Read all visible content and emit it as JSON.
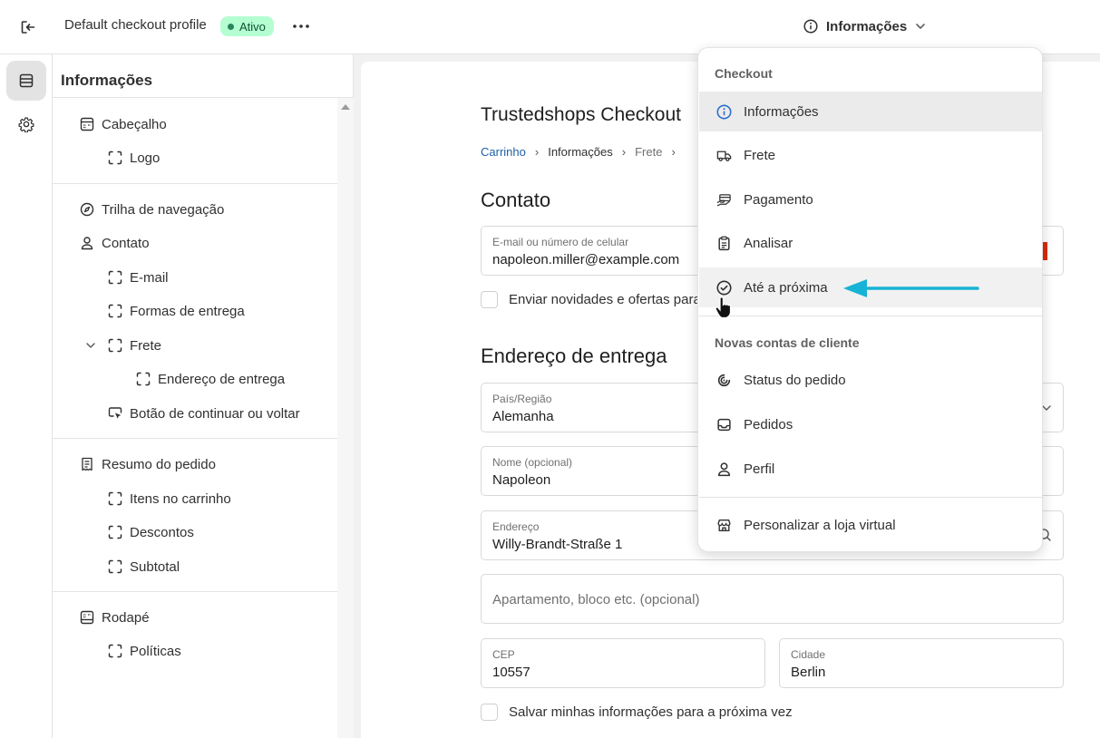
{
  "topbar": {
    "profile_name": "Default checkout profile",
    "status_badge": "Ativo",
    "page_selector": "Informações"
  },
  "sidebar": {
    "title": "Informações",
    "sections": [
      {
        "label": "Cabeçalho",
        "icon": "header-layout-icon",
        "children": [
          {
            "label": "Logo"
          }
        ]
      },
      {
        "label": "Trilha de navegação",
        "icon": "compass-icon"
      },
      {
        "label": "Contato",
        "icon": "person-icon",
        "children": [
          {
            "label": "E-mail"
          },
          {
            "label": "Formas de entrega"
          },
          {
            "label": "Frete",
            "expanded": true,
            "children": [
              {
                "label": "Endereço de entrega"
              }
            ]
          },
          {
            "label": "Botão de continuar ou voltar",
            "icon": "cursor-button-icon"
          }
        ]
      },
      {
        "label": "Resumo do pedido",
        "icon": "receipt-icon",
        "children": [
          {
            "label": "Itens no carrinho"
          },
          {
            "label": "Descontos"
          },
          {
            "label": "Subtotal"
          }
        ]
      },
      {
        "label": "Rodapé",
        "icon": "footer-layout-icon",
        "children": [
          {
            "label": "Políticas"
          }
        ]
      }
    ]
  },
  "preview": {
    "shop_title": "Trustedshops Checkout",
    "breadcrumb": [
      "Carrinho",
      "Informações",
      "Frete"
    ],
    "contact_heading": "Contato",
    "email_field": {
      "label": "E-mail ou número de celular",
      "value": "napoleon.miller@example.com"
    },
    "newsletter_label": "Enviar novidades e ofertas para",
    "shipping_heading": "Endereço de entrega",
    "country_field": {
      "label": "País/Região",
      "value": "Alemanha"
    },
    "name_field": {
      "label": "Nome (opcional)",
      "value": "Napoleon"
    },
    "address_field": {
      "label": "Endereço",
      "value": "Willy-Brandt-Straße 1"
    },
    "apartment_placeholder": "Apartamento, bloco etc. (opcional)",
    "cep_field": {
      "label": "CEP",
      "value": "10557"
    },
    "city_field": {
      "label": "Cidade",
      "value": "Berlin"
    },
    "save_info_label": "Salvar minhas informações para a próxima vez"
  },
  "dropdown": {
    "group_checkout": "Checkout",
    "checkout_items": [
      {
        "label": "Informações",
        "icon": "info-icon",
        "selected": true
      },
      {
        "label": "Frete",
        "icon": "truck-icon"
      },
      {
        "label": "Pagamento",
        "icon": "payment-hand-icon"
      },
      {
        "label": "Analisar",
        "icon": "clipboard-icon"
      },
      {
        "label": "Até a próxima",
        "icon": "check-circle-icon",
        "hovered": true
      }
    ],
    "group_accounts": "Novas contas de cliente",
    "account_items": [
      {
        "label": "Status do pedido",
        "icon": "order-status-icon"
      },
      {
        "label": "Pedidos",
        "icon": "inbox-icon"
      },
      {
        "label": "Perfil",
        "icon": "person-icon"
      }
    ],
    "footer_item": {
      "label": "Personalizar a loja virtual",
      "icon": "store-icon"
    }
  },
  "colors": {
    "accent_link": "#1e5fa8",
    "info_icon": "#2c6ecb",
    "badge_bg": "#b4fed2",
    "badge_text": "#0c5132",
    "annotation_arrow": "#17b3d6"
  }
}
